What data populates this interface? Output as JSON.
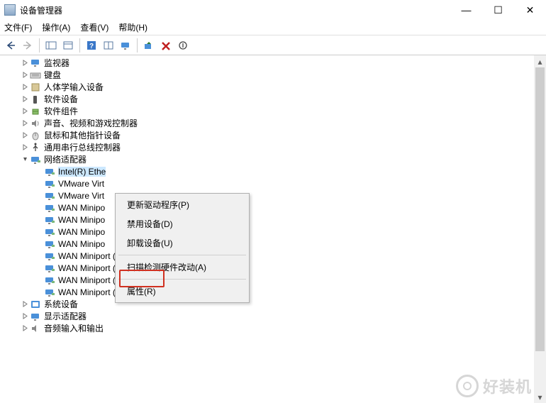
{
  "window": {
    "title": "设备管理器"
  },
  "win_buttons": {
    "min": "—",
    "max": "☐",
    "close": "✕"
  },
  "menubar": {
    "file": "文件(F)",
    "action": "操作(A)",
    "view": "查看(V)",
    "help": "帮助(H)"
  },
  "tree": {
    "nodes": [
      {
        "level": 1,
        "expander": "›",
        "icon": "monitor",
        "label": "监视器"
      },
      {
        "level": 1,
        "expander": "›",
        "icon": "keyboard",
        "label": "键盘"
      },
      {
        "level": 1,
        "expander": "›",
        "icon": "hid",
        "label": "人体学输入设备"
      },
      {
        "level": 1,
        "expander": "›",
        "icon": "software",
        "label": "软件设备"
      },
      {
        "level": 1,
        "expander": "›",
        "icon": "component",
        "label": "软件组件"
      },
      {
        "level": 1,
        "expander": "›",
        "icon": "audio",
        "label": "声音、视频和游戏控制器"
      },
      {
        "level": 1,
        "expander": "›",
        "icon": "mouse",
        "label": "鼠标和其他指针设备"
      },
      {
        "level": 1,
        "expander": "›",
        "icon": "usb",
        "label": "通用串行总线控制器"
      },
      {
        "level": 1,
        "expander": "v",
        "icon": "net",
        "label": "网络适配器"
      },
      {
        "level": 2,
        "expander": "",
        "icon": "net",
        "label": "Intel(R) Ethe",
        "selected": true
      },
      {
        "level": 2,
        "expander": "",
        "icon": "net",
        "label": "VMware Virt"
      },
      {
        "level": 2,
        "expander": "",
        "icon": "net",
        "label": "VMware Virt"
      },
      {
        "level": 2,
        "expander": "",
        "icon": "net",
        "label": "WAN Minipo"
      },
      {
        "level": 2,
        "expander": "",
        "icon": "net",
        "label": "WAN Minipo"
      },
      {
        "level": 2,
        "expander": "",
        "icon": "net",
        "label": "WAN Minipo"
      },
      {
        "level": 2,
        "expander": "",
        "icon": "net",
        "label": "WAN Minipo"
      },
      {
        "level": 2,
        "expander": "",
        "icon": "net",
        "label": "WAN Miniport (Network Monitor)"
      },
      {
        "level": 2,
        "expander": "",
        "icon": "net",
        "label": "WAN Miniport (PPPOE)"
      },
      {
        "level": 2,
        "expander": "",
        "icon": "net",
        "label": "WAN Miniport (PPTP)"
      },
      {
        "level": 2,
        "expander": "",
        "icon": "net",
        "label": "WAN Miniport (SSTP)"
      },
      {
        "level": 1,
        "expander": "›",
        "icon": "system",
        "label": "系统设备"
      },
      {
        "level": 1,
        "expander": "›",
        "icon": "display",
        "label": "显示适配器"
      },
      {
        "level": 1,
        "expander": "›",
        "icon": "audioio",
        "label": "音频输入和输出"
      }
    ]
  },
  "context_menu": {
    "items": [
      "更新驱动程序(P)",
      "禁用设备(D)",
      "卸载设备(U)",
      "扫描检测硬件改动(A)",
      "属性(R)"
    ]
  },
  "watermark": "好装机"
}
